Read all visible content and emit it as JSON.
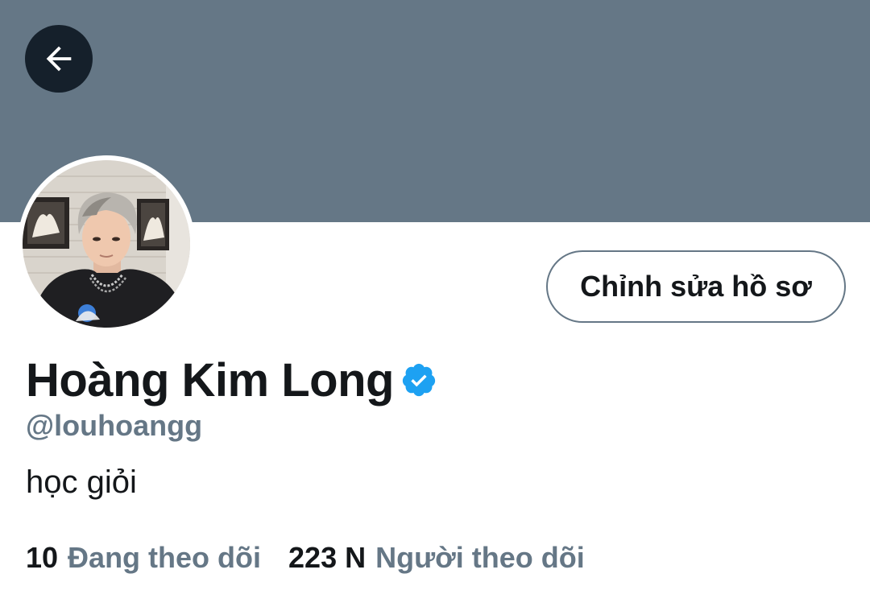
{
  "header": {
    "back_icon": "arrow-left-icon",
    "banner_color": "#657786"
  },
  "profile": {
    "edit_button_label": "Chỉnh sửa hồ sơ",
    "display_name": "Hoàng Kim Long",
    "verified_icon": "verified-badge-icon",
    "handle": "@louhoangg",
    "bio": "học giỏi",
    "following_count": "10",
    "following_label": "Đang theo dõi",
    "followers_count": "223 N",
    "followers_label": "Người theo dõi"
  },
  "colors": {
    "primary_text": "#14171a",
    "secondary_text": "#657786",
    "verified_blue": "#1da1f2",
    "back_button_bg": "#15202b"
  }
}
